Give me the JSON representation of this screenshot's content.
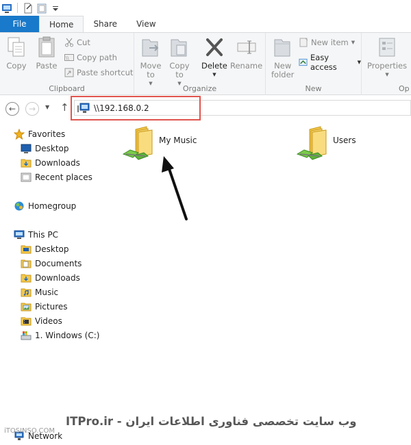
{
  "quick_access": {
    "icons": [
      "properties-icon",
      "new-folder-icon",
      "customize-icon"
    ]
  },
  "tabs": [
    {
      "label": "File",
      "active": false
    },
    {
      "label": "Home",
      "active": true
    },
    {
      "label": "Share",
      "active": false
    },
    {
      "label": "View",
      "active": false
    }
  ],
  "ribbon": {
    "clipboard": {
      "label": "Clipboard",
      "copy": "Copy",
      "paste": "Paste",
      "cut": "Cut",
      "copy_path": "Copy path",
      "paste_shortcut": "Paste shortcut"
    },
    "organize": {
      "label": "Organize",
      "move_to": "Move\nto",
      "copy_to": "Copy\nto",
      "delete": "Delete",
      "rename": "Rename"
    },
    "new": {
      "label": "New",
      "new_folder": "New\nfolder",
      "new_item": "New item",
      "easy_access": "Easy access"
    },
    "open": {
      "label": "Op",
      "properties": "Properties"
    }
  },
  "address": {
    "path": "\\\\192.168.0.2"
  },
  "nav": {
    "favorites": "Favorites",
    "fav_items": [
      "Desktop",
      "Downloads",
      "Recent places"
    ],
    "homegroup": "Homegroup",
    "this_pc": "This PC",
    "pc_items": [
      "Desktop",
      "Documents",
      "Downloads",
      "Music",
      "Pictures",
      "Videos",
      "1. Windows (C:)"
    ],
    "network": "Network"
  },
  "folders": [
    {
      "name": "My Music"
    },
    {
      "name": "Users"
    }
  ],
  "watermark": "ITPro.ir - وب سایت تخصصی فناوری اطلاعات ایران",
  "watermark2": "iTOSINSO.COM",
  "colors": {
    "file_tab": "#1979ca",
    "highlight": "#e0544d",
    "folder": "#f3c84c"
  }
}
